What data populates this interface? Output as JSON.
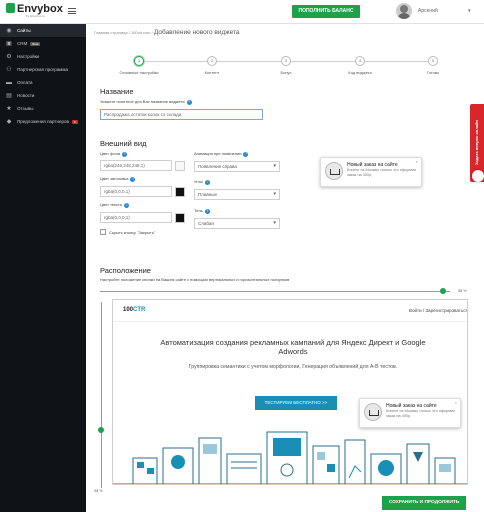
{
  "app": {
    "logo_main": "Envybox",
    "logo_sub": "by Envybox.io",
    "topup_button": "ПОПОЛНИТЬ БАЛАНС",
    "username": "Арсений"
  },
  "sidebar": {
    "items": [
      {
        "label": "Сайты",
        "icon": "globe-icon",
        "active": true
      },
      {
        "label": "CRM",
        "icon": "crm-icon",
        "badge": "Beta"
      },
      {
        "label": "Настройки",
        "icon": "gear-icon"
      },
      {
        "label": "Партнерская программа",
        "icon": "partners-icon"
      },
      {
        "label": "Оплата",
        "icon": "payment-icon"
      },
      {
        "label": "Новости",
        "icon": "news-icon"
      },
      {
        "label": "Отзывы",
        "icon": "star-icon"
      },
      {
        "label": "Предложения партнеров",
        "icon": "tag-icon",
        "badge": "0"
      }
    ]
  },
  "breadcrumbs": {
    "home": "Главная страница",
    "sep": "/",
    "site": "100ctr.com",
    "current": "Добавление нового виджета"
  },
  "steps": [
    {
      "num": "1",
      "label": "Основные настройки",
      "active": true
    },
    {
      "num": "2",
      "label": "Контент"
    },
    {
      "num": "3",
      "label": "Бонус"
    },
    {
      "num": "4",
      "label": "Код виджета"
    },
    {
      "num": "5",
      "label": "Готово"
    }
  ],
  "name_section": {
    "title": "Название",
    "hint": "Укажите понятное для Вас название виджета",
    "value": "Распродажа остатки колок со склада"
  },
  "appearance": {
    "title": "Внешний вид",
    "bg_label": "Цвет фона",
    "bg_value": "rgba(248,248,248,1)",
    "bg_swatch": "#f8f8f8",
    "title_color_label": "Цвет заголовка",
    "title_color_value": "rgba(0,0,0,1)",
    "title_swatch": "#111111",
    "text_color_label": "Цвет текста",
    "text_color_value": "rgba(0,0,0,1)",
    "text_swatch": "#111111",
    "hide_close_label": "Скрыть кнопку \"Закрыть\"",
    "animation_label": "Анимация при появлении",
    "animation_value": "Появление справа",
    "corners_label": "Углы",
    "corners_value": "Плавные",
    "shadow_label": "Тень",
    "shadow_value": "Слабая"
  },
  "notif_preview": {
    "title": "Новый заказ на сайте",
    "text": "Клиент из Москвы только что оформил заказ на 300р."
  },
  "position": {
    "title": "Расположение",
    "hint": "Настройте положение кнопки на Вашем сайте с помощью вертикальных и горизонтальных ползунков",
    "h_percent": "98 %",
    "v_percent": "98 %",
    "h_value": 0.98,
    "v_value": 0.98
  },
  "preview_site": {
    "logo_a": "100",
    "logo_b": "CTR",
    "login": "Войти / Зарегистрироваться",
    "headline": "Автоматизация создания рекламных кампаний для Яндекс Директ и Google Adwords",
    "subline": "Группировка семантики с учетом морфологии, Генерация объявлений для А-В тестов.",
    "cta": "ТЕСТИРУЕМ БЕСПЛАТНО >>"
  },
  "feedback_tab": "Задать вопрос онлайн",
  "save_button": "СОХРАНИТЬ И ПРОДОЛЖИТЬ",
  "colors": {
    "brand_green": "#1ca24b",
    "sidebar_bg": "#0f1217",
    "accent_blue": "#1a8fb5",
    "feedback_red": "#d9262b"
  }
}
